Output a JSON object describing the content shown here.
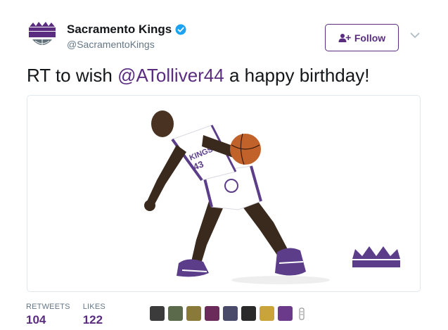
{
  "account": {
    "display_name": "Sacramento Kings",
    "handle": "@SacramentoKings",
    "logo_text_top": "SACRAMENTO",
    "logo_text_main": "KINGS",
    "verified_icon": "verified-badge-icon"
  },
  "actions": {
    "follow_label": "Follow",
    "follow_icon": "add-user-icon",
    "caret_icon": "chevron-down-icon"
  },
  "tweet": {
    "text_before": "RT to wish ",
    "mention": "@ATolliver44",
    "text_after": " a happy birthday!"
  },
  "media": {
    "subject": "basketball player dribbling, Kings uniform #43",
    "jersey_number": "43",
    "jersey_text": "KINGS",
    "crown_icon": "crown-logo-icon"
  },
  "stats": {
    "retweets_label": "RETWEETS",
    "retweets_value": "104",
    "likes_label": "LIKES",
    "likes_value": "122"
  },
  "likers": [
    {
      "name": "liker-avatar-1",
      "color": "#3b3b3b"
    },
    {
      "name": "liker-avatar-2",
      "color": "#5a6a4a"
    },
    {
      "name": "liker-avatar-3",
      "color": "#8a7a3a"
    },
    {
      "name": "liker-avatar-4",
      "color": "#6a2a5a"
    },
    {
      "name": "liker-avatar-5",
      "color": "#4a4a6a"
    },
    {
      "name": "liker-avatar-6",
      "color": "#2a2a2a"
    },
    {
      "name": "liker-avatar-7",
      "color": "#c8a43a"
    },
    {
      "name": "liker-avatar-8",
      "color": "#6b3a8a"
    }
  ],
  "colors": {
    "brand_purple": "#5a2d81",
    "verified_blue": "#1da1f2",
    "text": "#14171a",
    "muted": "#657786"
  }
}
